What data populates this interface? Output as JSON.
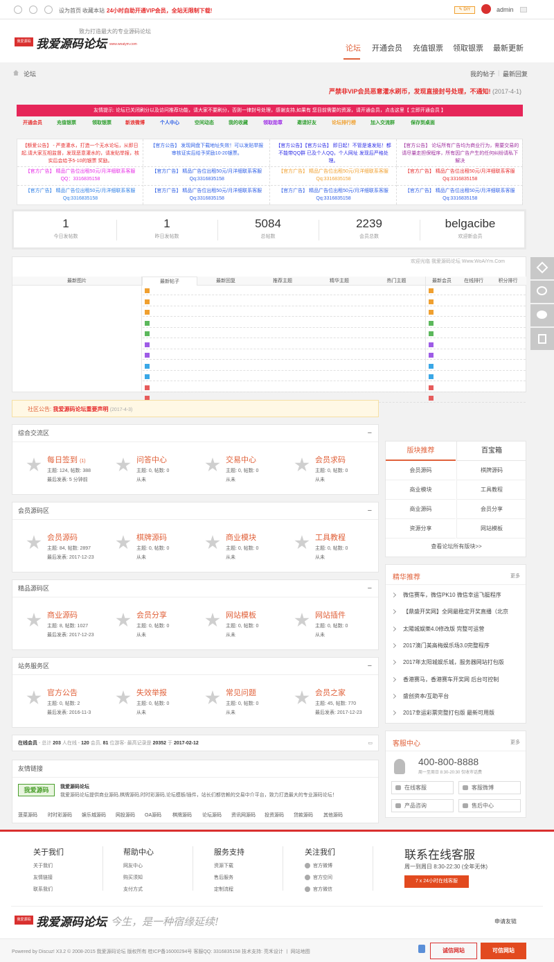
{
  "topbar": {
    "set_home": "设为首页",
    "favorite": "收藏本站",
    "promo": "24小时自助开通VIP会员，全站无限制下载!",
    "diy": "DIY",
    "username": "admin"
  },
  "header": {
    "logo_box": "我爱源码",
    "logo_text": "我爱源码论坛",
    "logo_url": "www.woaiym.com",
    "slogan": "致力打造最大的专业源码论坛",
    "nav": [
      "论坛",
      "开通会员",
      "充值银票",
      "领取银票",
      "最新更新"
    ]
  },
  "breadcrumb": {
    "current": "论坛",
    "my_posts": "我的帖子",
    "latest_reply": "最新回复"
  },
  "warning": {
    "text": "严禁非VIP会员恶意灌水刷币，发现直接封号处理，不通知!",
    "date": "(2017-4-1)"
  },
  "pink_notice": "友情提示: 论坛已关闭刷分以及访问推荐功能，请大家不要刷分，否则一律封号处理，感谢支持,如果有 您目前需要的资源，请开通会员，点击这里【 立即开通会员 】",
  "quick_links": [
    {
      "label": "开通会员",
      "color": "#e62e2e"
    },
    {
      "label": "充值银票",
      "color": "#2e9e2e"
    },
    {
      "label": "领取银票",
      "color": "#2e9e2e"
    },
    {
      "label": "新浪微博",
      "color": "#e62e2e"
    },
    {
      "label": "个人中心",
      "color": "#2e5fe6"
    },
    {
      "label": "空间动态",
      "color": "#2e9e2e"
    },
    {
      "label": "我的收藏",
      "color": "#2e9e2e"
    },
    {
      "label": "领取勋章",
      "color": "#9e2ee6"
    },
    {
      "label": "邀请好友",
      "color": "#2e9e2e"
    },
    {
      "label": "论坛排行榜",
      "color": "#f0a030"
    },
    {
      "label": "加入交流群",
      "color": "#2e9e2e"
    },
    {
      "label": "保存到桌面",
      "color": "#2e9e2e"
    }
  ],
  "ads": [
    {
      "notice": "【额爱公告】 - 严查灌水，打造一个无水论坛，从即日起,请大家互相监督，发现恶意灌水的，请发贴举报，核实后会给予5-10的银票 奖励。",
      "notice_color": "#e62e2e",
      "ad1": "【官方广告】 精品广告位出租50元/月洋细联系客服QQ：3316835158",
      "ad1_color": "#e62ee6",
      "ad2": "【官方广告】 精品广告位出租50元/月洋细联系客服Qq:3316835158",
      "ad2_color": "#2e7fe6"
    },
    {
      "notice": "【官方公告】 发现网盘下载地址失效！可以发贴举报 审核证实后给予奖励10-20银票。",
      "notice_color": "#2e5fe6",
      "ad1": "【官方广告】 精品广告位出租50元/月洋细联系客服Qq:3316835158",
      "ad1_color": "#2e5fe6",
      "ad2": "【官方广告】 精品广告位出租50元/月洋细联系客服Qq:3316835158",
      "ad2_color": "#2e5fe6"
    },
    {
      "notice": "【官方公告】【官方公告】 即日起！不管是谁发贴！都不能带QQ群 已及个人QQ。个人网址 发现后严格处理。",
      "notice_color": "#2e2ee6",
      "ad1": "【官方广告】 精品广告位出租50元/月洋细联系客服Qq:3316835158",
      "ad1_color": "#f0a030",
      "ad2": "【官方广告】 精品广告位出租50元/月洋细联系客服Qq:3316835158",
      "ad2_color": "#2e5fe6"
    },
    {
      "notice": "【官方公告】 论坛所有广告均为商业行为，需要交易的请尽量走担保程序，所有因广告产生的任何纠纷请私下解决",
      "notice_color": "#9e2e9e",
      "ad1": "【官方广告】 精品广告位出租50元/月洋细联系客服Qq:3316835158",
      "ad1_color": "#e62e2e",
      "ad2": "【官方广告】 精品广告位出租50元/月洋细联系客服Qq:3316835158",
      "ad2_color": "#2e5fe6"
    }
  ],
  "stats": [
    {
      "value": "1",
      "label": "今日发帖数"
    },
    {
      "value": "1",
      "label": "昨日发帖数"
    },
    {
      "value": "5084",
      "label": "总帖数"
    },
    {
      "value": "2239",
      "label": "会员总数"
    },
    {
      "value": "belgacibe",
      "label": "欢迎新会员"
    }
  ],
  "recent": {
    "welcome": "欢迎光临 我爱源码论坛 Www.WoAiYm.Com",
    "image_tab": "最新图片",
    "tabs": [
      "最新帖子",
      "最新回复",
      "推荐主题",
      "精华主题",
      "热门主题"
    ],
    "right_tabs": [
      "最新会员",
      "在线排行",
      "积分排行"
    ]
  },
  "notice": {
    "label": "社区公告:",
    "title": "我爱源码论坛重要声明",
    "date": "(2017-4-3)"
  },
  "categories": [
    {
      "name": "综合交流区",
      "forums": [
        {
          "name": "每日签到",
          "count": "(1)",
          "line1": "主题: 124, 帖数: 388",
          "line2": "最后发表: 5 分钟前"
        },
        {
          "name": "问答中心",
          "count": "",
          "line1": "主题: 0, 帖数: 0",
          "line2": "从未"
        },
        {
          "name": "交易中心",
          "count": "",
          "line1": "主题: 0, 帖数: 0",
          "line2": "从未"
        },
        {
          "name": "会员求码",
          "count": "",
          "line1": "主题: 0, 帖数: 0",
          "line2": "从未"
        }
      ]
    },
    {
      "name": "会员源码区",
      "forums": [
        {
          "name": "会员源码",
          "count": "",
          "line1": "主题: 84, 帖数: 2897",
          "line2": "最后发表: 2017-12-23"
        },
        {
          "name": "棋牌源码",
          "count": "",
          "line1": "主题: 0, 帖数: 0",
          "line2": "从未"
        },
        {
          "name": "商业模块",
          "count": "",
          "line1": "主题: 0, 帖数: 0",
          "line2": "从未"
        },
        {
          "name": "工具教程",
          "count": "",
          "line1": "主题: 0, 帖数: 0",
          "line2": "从未"
        }
      ]
    },
    {
      "name": "精品源码区",
      "forums": [
        {
          "name": "商业源码",
          "count": "",
          "line1": "主题: 8, 帖数: 1027",
          "line2": "最后发表: 2017-12-23"
        },
        {
          "name": "会员分享",
          "count": "",
          "line1": "主题: 0, 帖数: 0",
          "line2": "从未"
        },
        {
          "name": "网站模板",
          "count": "",
          "line1": "主题: 0, 帖数: 0",
          "line2": "从未"
        },
        {
          "name": "网站插件",
          "count": "",
          "line1": "主题: 0, 帖数: 0",
          "line2": "从未"
        }
      ]
    },
    {
      "name": "站务服务区",
      "forums": [
        {
          "name": "官方公告",
          "count": "",
          "line1": "主题: 0, 帖数: 2",
          "line2": "最后发表: 2016-11-3"
        },
        {
          "name": "失效举报",
          "count": "",
          "line1": "主题: 0, 帖数: 0",
          "line2": "从未"
        },
        {
          "name": "常见问题",
          "count": "",
          "line1": "主题: 0, 帖数: 0",
          "line2": "从未"
        },
        {
          "name": "会员之家",
          "count": "",
          "line1": "主题: 45, 帖数: 770",
          "line2": "最后发表: 2017-12-23"
        }
      ]
    }
  ],
  "online": {
    "label": "在线会员",
    "text1": "- 总计",
    "total": "203",
    "text2": "人在线 -",
    "members": "120",
    "text3": "会员,",
    "guests": "81",
    "text4": "位游客- 最高记录是",
    "record": "20352",
    "text5": "于",
    "record_date": "2017-02-12"
  },
  "friend_links": {
    "title": "友情链接",
    "logo": "我爱源码",
    "site_name": "我爱源码论坛",
    "site_desc": "我爱源码论坛提供商业源码,棋牌源码,时时彩源码,论坛模板/插件，站长们都信赖的交易中介平台，致力打造最大的专业源码论坛！",
    "links": [
      "菠菜源码",
      "时时彩源码",
      "娱乐城源码",
      "网投源码",
      "OA源码",
      "棋牌源码",
      "论坛源码",
      "资讯网源码",
      "投资源码",
      "贷款源码",
      "其他源码"
    ]
  },
  "sidebar": {
    "tab_active": "版块推荐",
    "tab_other": "百宝箱",
    "grid": [
      "会员源码",
      "棋牌源码",
      "商业模块",
      "工具教程",
      "商业源码",
      "会员分享",
      "资源分享",
      "网站模板"
    ],
    "view_all": "查看论坛所有版块>>",
    "featured_title": "精华推荐",
    "more": "更多",
    "featured": [
      "微信赛车，微信PK10 微信幸运飞艇程序",
      "【鼎盛开奖网】全网最稳定开奖直播（北京",
      "太陽城娱樂4.0修改版 完整可运营",
      "2017澳门美高梅娱乐场3.0完整程序",
      "2017年太阳城娱乐城，服务器网站打包版",
      "香港赛马，香港赛车开奖网 后台可控制",
      "盛创资本/互助平台",
      "2017幸运彩票完整打包版 最新可用版"
    ],
    "service_title": "客服中心",
    "phone": "400-800-8888",
    "hours": "周一至周日 8:30-20:30 仅收市话费",
    "buttons": [
      "在线客服",
      "客服微博",
      "产品咨询",
      "售后中心"
    ]
  },
  "footer": {
    "columns": [
      {
        "title": "关于我们",
        "items": [
          "关于我们",
          "友情链接",
          "联系我们"
        ]
      },
      {
        "title": "帮助中心",
        "items": [
          "网友中心",
          "购买须知",
          "支付方式"
        ]
      },
      {
        "title": "服务支持",
        "items": [
          "资源下载",
          "售后服务",
          "定制流程"
        ]
      },
      {
        "title": "关注我们",
        "items": [
          "官方微博",
          "官方空间",
          "官方微信"
        ]
      }
    ],
    "contact_title": "联系在线客服",
    "contact_hours": "周一到周日 8:30-22:30 (全年无休)",
    "contact_button": "7 x 24小时在线客服",
    "logo_box": "我爱源码",
    "logo_text": "我爱源码论坛",
    "handwriting": "今生，是一种宿缘延续!",
    "apply_link": "申请友链",
    "copyright": "Powered by Discuz! X3.2 © 2008-2015 我爱源码论坛 版权所有 桂ICP备16000294号 客服QQ: 3316835158 技术支持: 亮禾设计 丨 网站地图",
    "badge1": "诚信网站",
    "badge2": "可信网站"
  }
}
